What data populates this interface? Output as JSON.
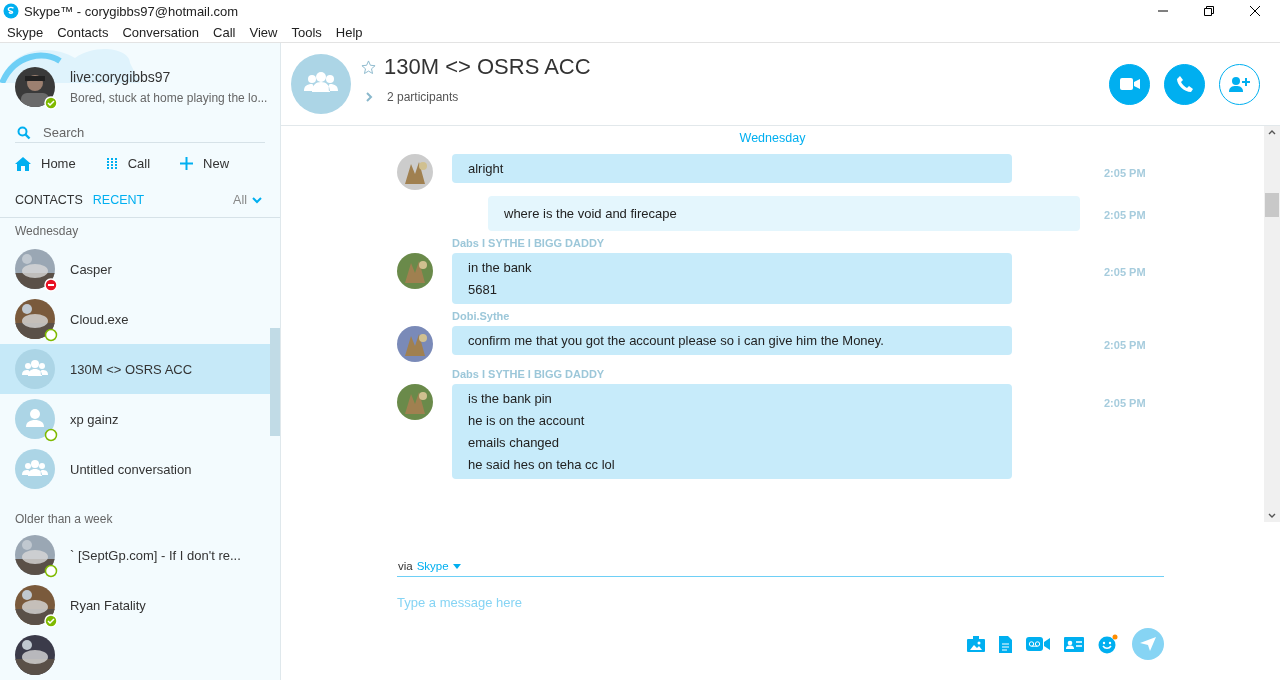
{
  "window": {
    "title": "Skype™ - corygibbs97@hotmail.com"
  },
  "menu": [
    "Skype",
    "Contacts",
    "Conversation",
    "Call",
    "View",
    "Tools",
    "Help"
  ],
  "profile": {
    "name": "live:corygibbs97",
    "mood": "Bored, stuck at home playing the lo...",
    "badge": {
      "kind": "available"
    }
  },
  "search": {
    "placeholder": "Search"
  },
  "nav": [
    {
      "label": "Home",
      "kind": "home"
    },
    {
      "label": "Call",
      "kind": "dialpad"
    },
    {
      "label": "New",
      "kind": "plus"
    }
  ],
  "tabs": [
    {
      "label": "CONTACTS",
      "selected": false
    },
    {
      "label": "RECENT",
      "selected": true
    }
  ],
  "filter": "All",
  "groups": [
    {
      "heading": "Wednesday",
      "items": [
        {
          "name": "Casper",
          "kind": "picture",
          "badge": {
            "kind": "busy"
          },
          "selected": false
        },
        {
          "name": "Cloud.exe",
          "kind": "picture",
          "badge": {
            "kind": "ring"
          },
          "selected": false
        },
        {
          "name": "130M <> OSRS ACC",
          "kind": "group",
          "selected": true
        },
        {
          "name": "xp gainz",
          "kind": "person",
          "badge": {
            "kind": "ring"
          },
          "selected": false
        },
        {
          "name": "Untitled conversation",
          "kind": "group",
          "selected": false
        }
      ]
    },
    {
      "heading": "Older than a week",
      "items": [
        {
          "name": "` [SeptGp.com] - If I don't re...",
          "kind": "picture",
          "badge": {
            "kind": "ring"
          },
          "selected": false
        },
        {
          "name": "Ryan Fatality",
          "kind": "picture",
          "badge": {
            "kind": "available"
          },
          "selected": false
        },
        {
          "kind": "picture",
          "selected": false
        }
      ]
    }
  ],
  "conversation": {
    "title": "130M <> OSRS ACC",
    "favorite": false,
    "participants": "2 participants"
  },
  "day_banner": "Wednesday",
  "messages": [
    {
      "outgoing": false,
      "lines": [
        "alright"
      ],
      "time": "2:05 PM"
    },
    {
      "outgoing": true,
      "lines": [
        "where is the void and firecape"
      ],
      "time": "2:05 PM"
    },
    {
      "sender": "Dabs I SYTHE I BIGG DADDY",
      "outgoing": false,
      "lines": [
        "in the bank",
        "5681"
      ],
      "time": "2:05 PM"
    },
    {
      "sender": "Dobi.Sythe",
      "outgoing": false,
      "lines": [
        "confirm me that you got the account please so i can give him the Money."
      ],
      "time": "2:05 PM"
    },
    {
      "sender": "Dabs I SYTHE I BIGG DADDY",
      "outgoing": false,
      "lines": [
        "is the bank pin",
        "he is on the account",
        "emails changed",
        "he said hes on teha cc lol"
      ],
      "time": "2:05 PM"
    }
  ],
  "composer": {
    "via": "via",
    "service": "Skype",
    "placeholder": "Type a message here"
  }
}
